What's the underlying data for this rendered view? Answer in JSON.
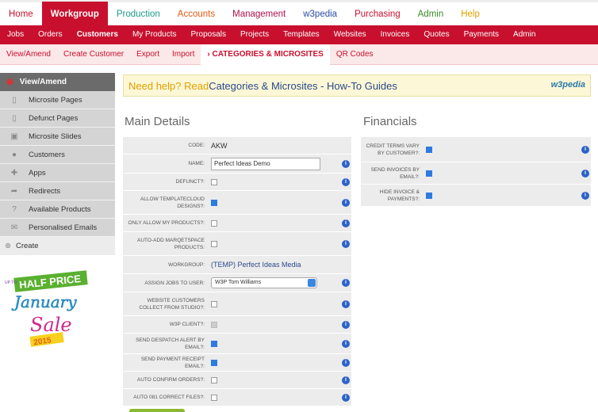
{
  "topnav": [
    "Home",
    "Workgroup",
    "Production",
    "Accounts",
    "Management",
    "w3pedia",
    "Purchasing",
    "Admin",
    "Help"
  ],
  "subnav": [
    "Jobs",
    "Orders",
    "Customers",
    "My Products",
    "Proposals",
    "Projects",
    "Templates",
    "Websites",
    "Invoices",
    "Quotes",
    "Payments",
    "Admin"
  ],
  "thirdnav": [
    "View/Amend",
    "Create Customer",
    "Export",
    "Import",
    "› CATEGORIES & MICROSITES",
    "QR Codes"
  ],
  "sidebar": {
    "head": "View/Amend",
    "items": [
      "Microsite Pages",
      "Defunct Pages",
      "Microsite Slides",
      "Customers",
      "Apps",
      "Redirects",
      "Available Products",
      "Personalised Emails"
    ],
    "create": "Create"
  },
  "promo": {
    "line1": "HALF PRICE",
    "line2": "January",
    "line3": "Sale",
    "line4": "2015",
    "tag": "UP TO"
  },
  "help": {
    "prefix": "Need help? Read ",
    "link": "Categories & Microsites - How-To Guides",
    "logo": "w3pedia"
  },
  "main": {
    "title": "Main Details",
    "code_label": "CODE:",
    "code": "AKW",
    "name_label": "NAME:",
    "name": "Perfect Ideas Demo",
    "defunct": "DEFUNCT?:",
    "allow": "ALLOW TEMPLATECLOUD DESIGNS?:",
    "only": "ONLY ALLOW MY PRODUCTS?:",
    "autoadd": "AUTO-ADD MARQETSPACE PRODUCTS:",
    "wg_label": "WORKGROUP:",
    "workgroup": "(TEMP) Perfect Ideas Media",
    "assign_label": "ASSIGN JOBS TO USER:",
    "assign": "W3P Tom Williams",
    "website": "WEBSITE CUSTOMERS COLLECT FROM STUDIO?:",
    "w3p": "W3P CLIENT?:",
    "despatch": "SEND DESPATCH ALERT BY EMAIL?:",
    "receipt": "SEND PAYMENT RECEIPT EMAIL?:",
    "confirm": "AUTO CONFIRM ORDERS?:",
    "correct": "AUTO 081 CORRECT FILES?:"
  },
  "fin": {
    "title": "Financials",
    "credit": "CREDIT TERMS VARY BY CUSTOMER?:",
    "invoices": "SEND INVOICES BY EMAIL?:",
    "hide": "HIDE INVOICE & PAYMENTS?:"
  }
}
